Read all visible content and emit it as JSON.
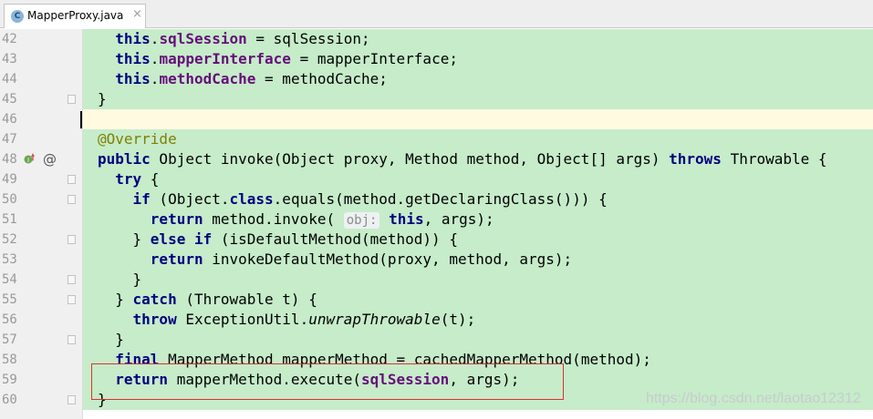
{
  "tab": {
    "icon_letter": "C",
    "filename": "MapperProxy.java",
    "close": "×"
  },
  "watermark": "https://blog.csdn.net/laotao12312",
  "lines": [
    {
      "n": "42",
      "fold": false,
      "tokens": [
        [
          "  ",
          ""
        ],
        [
          "this",
          "kw"
        ],
        [
          ".",
          ""
        ],
        [
          "sqlSession",
          "fld"
        ],
        [
          " = sqlSession;",
          ""
        ]
      ]
    },
    {
      "n": "43",
      "fold": false,
      "tokens": [
        [
          "  ",
          ""
        ],
        [
          "this",
          "kw"
        ],
        [
          ".",
          ""
        ],
        [
          "mapperInterface",
          "fld"
        ],
        [
          " = mapperInterface;",
          ""
        ]
      ]
    },
    {
      "n": "44",
      "fold": false,
      "tokens": [
        [
          "  ",
          ""
        ],
        [
          "this",
          "kw"
        ],
        [
          ".",
          ""
        ],
        [
          "methodCache",
          "fld"
        ],
        [
          " = methodCache;",
          ""
        ]
      ]
    },
    {
      "n": "45",
      "fold": true,
      "tokens": [
        [
          "}",
          ""
        ]
      ]
    },
    {
      "n": "46",
      "fold": false,
      "current": true,
      "tokens": []
    },
    {
      "n": "47",
      "fold": false,
      "tokens": [
        [
          "@Override",
          "ann"
        ]
      ]
    },
    {
      "n": "48",
      "fold": false,
      "tokens": [
        [
          "public",
          "kw"
        ],
        [
          " Object invoke(Object proxy, Method method, Object[] args) ",
          ""
        ],
        [
          "throws",
          "kw"
        ],
        [
          " Throwable {",
          ""
        ]
      ]
    },
    {
      "n": "49",
      "fold": true,
      "tokens": [
        [
          "  ",
          ""
        ],
        [
          "try",
          "kw"
        ],
        [
          " {",
          ""
        ]
      ]
    },
    {
      "n": "50",
      "fold": true,
      "tokens": [
        [
          "    ",
          ""
        ],
        [
          "if",
          "kw"
        ],
        [
          " (Object.",
          ""
        ],
        [
          "class",
          "kw"
        ],
        [
          ".equals(method.getDeclaringClass())) {",
          ""
        ]
      ]
    },
    {
      "n": "51",
      "fold": false,
      "tokens": [
        [
          "      ",
          ""
        ],
        [
          "return",
          "kw"
        ],
        [
          " method.invoke( ",
          ""
        ],
        [
          "obj:",
          "hint"
        ],
        [
          " ",
          ""
        ],
        [
          "this",
          "kw"
        ],
        [
          ", args);",
          ""
        ]
      ]
    },
    {
      "n": "52",
      "fold": true,
      "tokens": [
        [
          "    } ",
          ""
        ],
        [
          "else if",
          "kw"
        ],
        [
          " (isDefaultMethod(method)) {",
          ""
        ]
      ]
    },
    {
      "n": "53",
      "fold": false,
      "tokens": [
        [
          "      ",
          ""
        ],
        [
          "return",
          "kw"
        ],
        [
          " invokeDefaultMethod(proxy, method, args);",
          ""
        ]
      ]
    },
    {
      "n": "54",
      "fold": true,
      "tokens": [
        [
          "    }",
          ""
        ]
      ]
    },
    {
      "n": "55",
      "fold": true,
      "tokens": [
        [
          "  } ",
          ""
        ],
        [
          "catch",
          "kw"
        ],
        [
          " (Throwable t) {",
          ""
        ]
      ]
    },
    {
      "n": "56",
      "fold": false,
      "tokens": [
        [
          "    ",
          ""
        ],
        [
          "throw",
          "kw"
        ],
        [
          " ExceptionUtil.",
          ""
        ],
        [
          "unwrapThrowable",
          "it"
        ],
        [
          "(t);",
          ""
        ]
      ]
    },
    {
      "n": "57",
      "fold": true,
      "tokens": [
        [
          "  }",
          ""
        ]
      ]
    },
    {
      "n": "58",
      "fold": false,
      "tokens": [
        [
          "  ",
          ""
        ],
        [
          "final",
          "kw"
        ],
        [
          " MapperMethod mapperMethod = cachedMapperMethod(method);",
          ""
        ]
      ]
    },
    {
      "n": "59",
      "fold": false,
      "tokens": [
        [
          "  ",
          ""
        ],
        [
          "return",
          "kw"
        ],
        [
          " mapperMethod.execute(",
          ""
        ],
        [
          "sqlSession",
          "fld"
        ],
        [
          ", args);",
          ""
        ]
      ]
    },
    {
      "n": "60",
      "fold": true,
      "tokens": [
        [
          "}",
          ""
        ]
      ]
    }
  ]
}
